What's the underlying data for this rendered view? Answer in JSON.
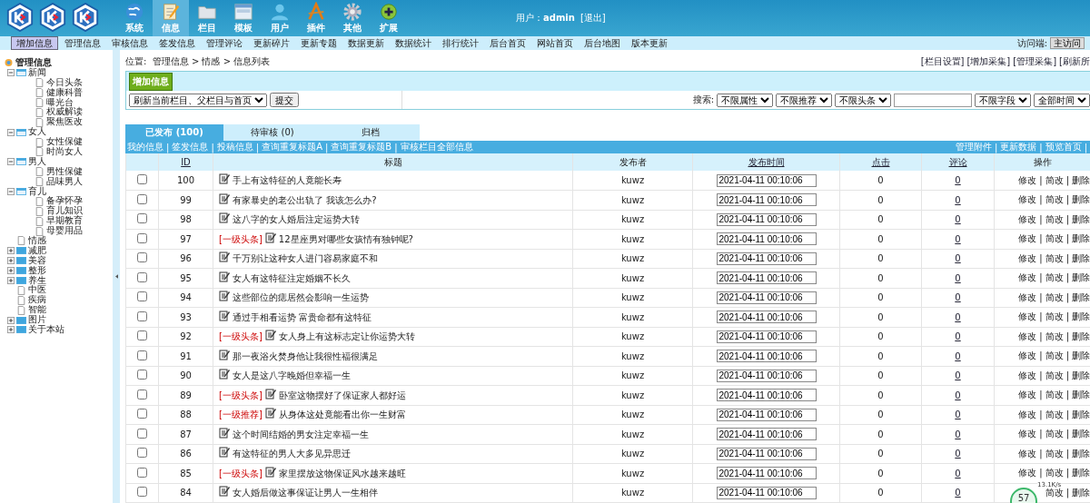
{
  "header": {
    "nav": [
      {
        "label": "系统",
        "kind": "globe",
        "selected": false
      },
      {
        "label": "信息",
        "kind": "note",
        "selected": true
      },
      {
        "label": "栏目",
        "kind": "folder",
        "selected": false
      },
      {
        "label": "模板",
        "kind": "window",
        "selected": false
      },
      {
        "label": "用户",
        "kind": "user",
        "selected": false
      },
      {
        "label": "插件",
        "kind": "tools",
        "selected": false
      },
      {
        "label": "其他",
        "kind": "gear",
        "selected": false
      },
      {
        "label": "扩展",
        "kind": "plus",
        "selected": false
      }
    ],
    "user": {
      "label": "用户：",
      "name": "admin",
      "logout": "[退出]"
    }
  },
  "menu": {
    "items": [
      {
        "label": "增加信息",
        "selected": true
      },
      {
        "label": "管理信息",
        "selected": false
      },
      {
        "label": "审核信息",
        "selected": false
      },
      {
        "label": "签发信息",
        "selected": false
      },
      {
        "label": "管理评论",
        "selected": false
      },
      {
        "label": "更新碎片",
        "selected": false
      },
      {
        "label": "更新专题",
        "selected": false
      },
      {
        "label": "数据更新",
        "selected": false
      },
      {
        "label": "数据统计",
        "selected": false
      },
      {
        "label": "排行统计",
        "selected": false
      },
      {
        "label": "后台首页",
        "selected": false
      },
      {
        "label": "网站首页",
        "selected": false
      },
      {
        "label": "后台地图",
        "selected": false
      },
      {
        "label": "版本更新",
        "selected": false
      }
    ],
    "client_label": "访问端:",
    "client_value": "主访问"
  },
  "sidebar": {
    "title": "管理信息",
    "tree": [
      {
        "label": "新闻",
        "kind": "folder",
        "expanded": true,
        "children": [
          {
            "label": "今日头条",
            "kind": "page"
          },
          {
            "label": "健康科普",
            "kind": "page"
          },
          {
            "label": "曝光台",
            "kind": "page"
          },
          {
            "label": "权威解读",
            "kind": "page"
          },
          {
            "label": "聚焦医改",
            "kind": "page"
          }
        ]
      },
      {
        "label": "女人",
        "kind": "folder",
        "expanded": true,
        "children": [
          {
            "label": "女性保健",
            "kind": "page"
          },
          {
            "label": "时尚女人",
            "kind": "page"
          }
        ]
      },
      {
        "label": "男人",
        "kind": "folder",
        "expanded": true,
        "children": [
          {
            "label": "男性保健",
            "kind": "page"
          },
          {
            "label": "品味男人",
            "kind": "page"
          }
        ]
      },
      {
        "label": "育儿",
        "kind": "folder",
        "expanded": true,
        "children": [
          {
            "label": "备孕怀孕",
            "kind": "page"
          },
          {
            "label": "育儿知识",
            "kind": "page"
          },
          {
            "label": "早期教育",
            "kind": "page"
          },
          {
            "label": "母婴用品",
            "kind": "page"
          }
        ]
      },
      {
        "label": "情感",
        "kind": "page"
      },
      {
        "label": "减肥",
        "kind": "folder",
        "expanded": false
      },
      {
        "label": "美容",
        "kind": "folder",
        "expanded": false
      },
      {
        "label": "整形",
        "kind": "folder",
        "expanded": false
      },
      {
        "label": "养生",
        "kind": "folder",
        "expanded": false
      },
      {
        "label": "中医",
        "kind": "page"
      },
      {
        "label": "疾病",
        "kind": "page"
      },
      {
        "label": "智能",
        "kind": "page"
      },
      {
        "label": "图片",
        "kind": "folder",
        "expanded": false
      },
      {
        "label": "关于本站",
        "kind": "folder",
        "expanded": false
      }
    ]
  },
  "main": {
    "breadcrumb_label": "位置:",
    "breadcrumb": [
      "管理信息",
      "情感",
      "信息列表"
    ],
    "breadcrumb_sep": ">",
    "top_links": [
      "[栏目设置]",
      "[增加采集]",
      "[管理采集]",
      "[刷新所"
    ],
    "add_button": "增加信息",
    "refresh_select": "刷新当前栏目、父栏目与首页",
    "submit_button": "提交",
    "search_label": "搜索:",
    "filters_a": [
      "不限属性",
      "不限推荐",
      "不限头条"
    ],
    "filters_b": [
      "不限字段",
      "全部时间"
    ],
    "tabs": [
      {
        "label": "已发布 (100)",
        "selected": true
      },
      {
        "label": "待审核 (0)",
        "selected": false
      },
      {
        "label": "归档",
        "selected": false
      }
    ],
    "left_links": [
      "我的信息",
      "签发信息",
      "投稿信息",
      "查询重复标题A",
      "查询重复标题B",
      "审核栏目全部信息"
    ],
    "right_links": [
      "管理附件",
      "更新数据",
      "预览首页"
    ],
    "link_sep": "|"
  },
  "table": {
    "columns": [
      {
        "label": "ID",
        "link": true
      },
      {
        "label": "标题",
        "link": false
      },
      {
        "label": "发布者",
        "link": false
      },
      {
        "label": "发布时间",
        "link": true
      },
      {
        "label": "点击",
        "link": true
      },
      {
        "label": "评论",
        "link": true
      },
      {
        "label": "操作",
        "link": false
      }
    ],
    "rows": [
      {
        "checked": false,
        "id": "100",
        "tag": "",
        "title": "手上有这特征的人竟能长寿",
        "author": "kuwz",
        "time": "2021-04-11 00:10:06",
        "clicks": "0",
        "comments": "0",
        "actions": [
          "修改",
          "简改",
          "删除"
        ]
      },
      {
        "checked": false,
        "id": "99",
        "tag": "",
        "title": "有家暴史的老公出轨了 我该怎么办?",
        "author": "kuwz",
        "time": "2021-04-11 00:10:06",
        "clicks": "0",
        "comments": "0",
        "actions": [
          "修改",
          "简改",
          "删除"
        ]
      },
      {
        "checked": false,
        "id": "98",
        "tag": "",
        "title": "这八字的女人婚后注定运势大转",
        "author": "kuwz",
        "time": "2021-04-11 00:10:06",
        "clicks": "0",
        "comments": "0",
        "actions": [
          "修改",
          "简改",
          "删除"
        ]
      },
      {
        "checked": false,
        "id": "97",
        "tag": "[一级头条]",
        "title": "12星座男对哪些女孩情有独钟呢?",
        "author": "kuwz",
        "time": "2021-04-11 00:10:06",
        "clicks": "0",
        "comments": "0",
        "actions": [
          "修改",
          "简改",
          "删除"
        ]
      },
      {
        "checked": false,
        "id": "96",
        "tag": "",
        "title": "千万别让这种女人进门容易家庭不和",
        "author": "kuwz",
        "time": "2021-04-11 00:10:06",
        "clicks": "0",
        "comments": "0",
        "actions": [
          "修改",
          "简改",
          "删除"
        ]
      },
      {
        "checked": false,
        "id": "95",
        "tag": "",
        "title": "女人有这特征注定婚姻不长久",
        "author": "kuwz",
        "time": "2021-04-11 00:10:06",
        "clicks": "0",
        "comments": "0",
        "actions": [
          "修改",
          "简改",
          "删除"
        ]
      },
      {
        "checked": false,
        "id": "94",
        "tag": "",
        "title": "这些部位的痣居然会影响一生运势",
        "author": "kuwz",
        "time": "2021-04-11 00:10:06",
        "clicks": "0",
        "comments": "0",
        "actions": [
          "修改",
          "简改",
          "删除"
        ]
      },
      {
        "checked": false,
        "id": "93",
        "tag": "",
        "title": "通过手相看运势 富贵命都有这特征",
        "author": "kuwz",
        "time": "2021-04-11 00:10:06",
        "clicks": "0",
        "comments": "0",
        "actions": [
          "修改",
          "简改",
          "删除"
        ]
      },
      {
        "checked": false,
        "id": "92",
        "tag": "[一级头条]",
        "title": "女人身上有这标志定让你运势大转",
        "author": "kuwz",
        "time": "2021-04-11 00:10:06",
        "clicks": "0",
        "comments": "0",
        "actions": [
          "修改",
          "简改",
          "删除"
        ]
      },
      {
        "checked": false,
        "id": "91",
        "tag": "",
        "title": "那一夜浴火焚身他让我很性福很满足",
        "author": "kuwz",
        "time": "2021-04-11 00:10:06",
        "clicks": "0",
        "comments": "0",
        "actions": [
          "修改",
          "简改",
          "删除"
        ]
      },
      {
        "checked": false,
        "id": "90",
        "tag": "",
        "title": "女人是这八字晚婚但幸福一生",
        "author": "kuwz",
        "time": "2021-04-11 00:10:06",
        "clicks": "0",
        "comments": "0",
        "actions": [
          "修改",
          "简改",
          "删除"
        ]
      },
      {
        "checked": false,
        "id": "89",
        "tag": "[一级头条]",
        "title": "卧室这物摆好了保证家人都好运",
        "author": "kuwz",
        "time": "2021-04-11 00:10:06",
        "clicks": "0",
        "comments": "0",
        "actions": [
          "修改",
          "简改",
          "删除"
        ]
      },
      {
        "checked": false,
        "id": "88",
        "tag": "[一级推荐]",
        "title": "从身体这处竟能看出你一生财富",
        "author": "kuwz",
        "time": "2021-04-11 00:10:06",
        "clicks": "0",
        "comments": "0",
        "actions": [
          "修改",
          "简改",
          "删除"
        ]
      },
      {
        "checked": false,
        "id": "87",
        "tag": "",
        "title": "这个时间结婚的男女注定幸福一生",
        "author": "kuwz",
        "time": "2021-04-11 00:10:06",
        "clicks": "0",
        "comments": "0",
        "actions": [
          "修改",
          "简改",
          "删除"
        ]
      },
      {
        "checked": false,
        "id": "86",
        "tag": "",
        "title": "有这特征的男人大多见异思迁",
        "author": "kuwz",
        "time": "2021-04-11 00:10:06",
        "clicks": "0",
        "comments": "0",
        "actions": [
          "修改",
          "简改",
          "删除"
        ]
      },
      {
        "checked": false,
        "id": "85",
        "tag": "[一级头条]",
        "title": "家里摆放这物保证风水越来越旺",
        "author": "kuwz",
        "time": "2021-04-11 00:10:06",
        "clicks": "0",
        "comments": "0",
        "actions": [
          "修改",
          "简改",
          "删除"
        ]
      },
      {
        "checked": false,
        "id": "84",
        "tag": "",
        "title": "女人婚后做这事保证让男人一生相伴",
        "author": "kuwz",
        "time": "2021-04-11 00:10:06",
        "clicks": "0",
        "comments": "0",
        "actions": [
          "简改",
          "删除"
        ]
      }
    ]
  },
  "speed_widget": {
    "percent": "57",
    "rate": "13.1K/s"
  }
}
